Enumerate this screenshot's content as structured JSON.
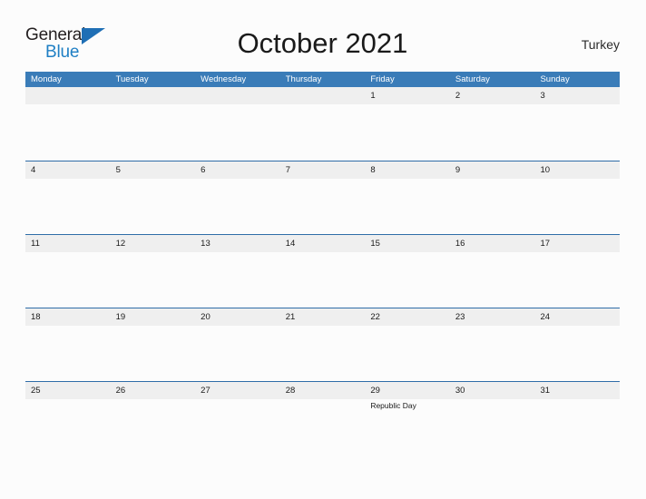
{
  "brand": {
    "name_line1": "General",
    "name_line2": "Blue",
    "triangle_color": "#1f6fb5",
    "blue_text_color": "#1f7fc4"
  },
  "header": {
    "title": "October 2021",
    "locale": "Turkey"
  },
  "calendar": {
    "accent_color": "#3a7cb8",
    "band_color": "#efefef",
    "rule_color": "#2f6da8",
    "weekdays": [
      "Monday",
      "Tuesday",
      "Wednesday",
      "Thursday",
      "Friday",
      "Saturday",
      "Sunday"
    ],
    "weeks": [
      {
        "days": [
          {
            "date": "",
            "event": ""
          },
          {
            "date": "",
            "event": ""
          },
          {
            "date": "",
            "event": ""
          },
          {
            "date": "",
            "event": ""
          },
          {
            "date": "1",
            "event": ""
          },
          {
            "date": "2",
            "event": ""
          },
          {
            "date": "3",
            "event": ""
          }
        ]
      },
      {
        "days": [
          {
            "date": "4",
            "event": ""
          },
          {
            "date": "5",
            "event": ""
          },
          {
            "date": "6",
            "event": ""
          },
          {
            "date": "7",
            "event": ""
          },
          {
            "date": "8",
            "event": ""
          },
          {
            "date": "9",
            "event": ""
          },
          {
            "date": "10",
            "event": ""
          }
        ]
      },
      {
        "days": [
          {
            "date": "11",
            "event": ""
          },
          {
            "date": "12",
            "event": ""
          },
          {
            "date": "13",
            "event": ""
          },
          {
            "date": "14",
            "event": ""
          },
          {
            "date": "15",
            "event": ""
          },
          {
            "date": "16",
            "event": ""
          },
          {
            "date": "17",
            "event": ""
          }
        ]
      },
      {
        "days": [
          {
            "date": "18",
            "event": ""
          },
          {
            "date": "19",
            "event": ""
          },
          {
            "date": "20",
            "event": ""
          },
          {
            "date": "21",
            "event": ""
          },
          {
            "date": "22",
            "event": ""
          },
          {
            "date": "23",
            "event": ""
          },
          {
            "date": "24",
            "event": ""
          }
        ]
      },
      {
        "days": [
          {
            "date": "25",
            "event": ""
          },
          {
            "date": "26",
            "event": ""
          },
          {
            "date": "27",
            "event": ""
          },
          {
            "date": "28",
            "event": ""
          },
          {
            "date": "29",
            "event": "Republic Day"
          },
          {
            "date": "30",
            "event": ""
          },
          {
            "date": "31",
            "event": ""
          }
        ]
      }
    ]
  }
}
